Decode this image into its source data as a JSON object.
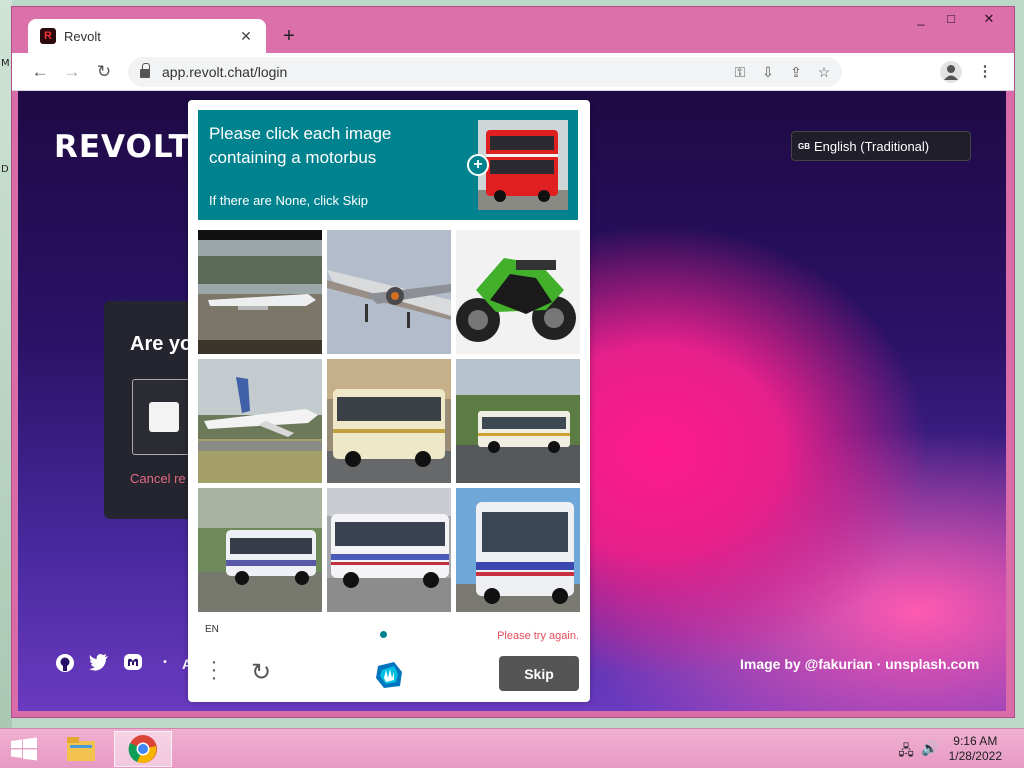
{
  "browser": {
    "tab_title": "Revolt",
    "tab_favicon": "R",
    "url": "app.revolt.chat/login",
    "window_controls": {
      "minimize": "_",
      "maximize": "□",
      "close": "✕"
    }
  },
  "page": {
    "logo": "REVOLT",
    "language_select": {
      "flag": "GB",
      "value": "English (Traditional)"
    },
    "card_title": "Are yo",
    "cancel_link": "Cancel re",
    "image_credit": "Image by @fakurian · unsplash.com",
    "social_icons": [
      "github-icon",
      "twitter-icon",
      "mastodon-icon"
    ],
    "footer_partial": "A"
  },
  "captcha": {
    "prompt": "Please click each image containing a motorbus",
    "hint": "If there are None, click Skip",
    "tiles": [
      "airplane-on-runway",
      "airplane-landing",
      "motorcycle",
      "airplane-taking-off",
      "bus",
      "bus",
      "bus",
      "bus",
      "bus"
    ],
    "language": "EN",
    "error": "Please try again.",
    "skip_label": "Skip",
    "accent_color": "#00838f",
    "error_color": "#e34d5a"
  },
  "taskbar": {
    "time": "9:16 AM",
    "date": "1/28/2022"
  }
}
